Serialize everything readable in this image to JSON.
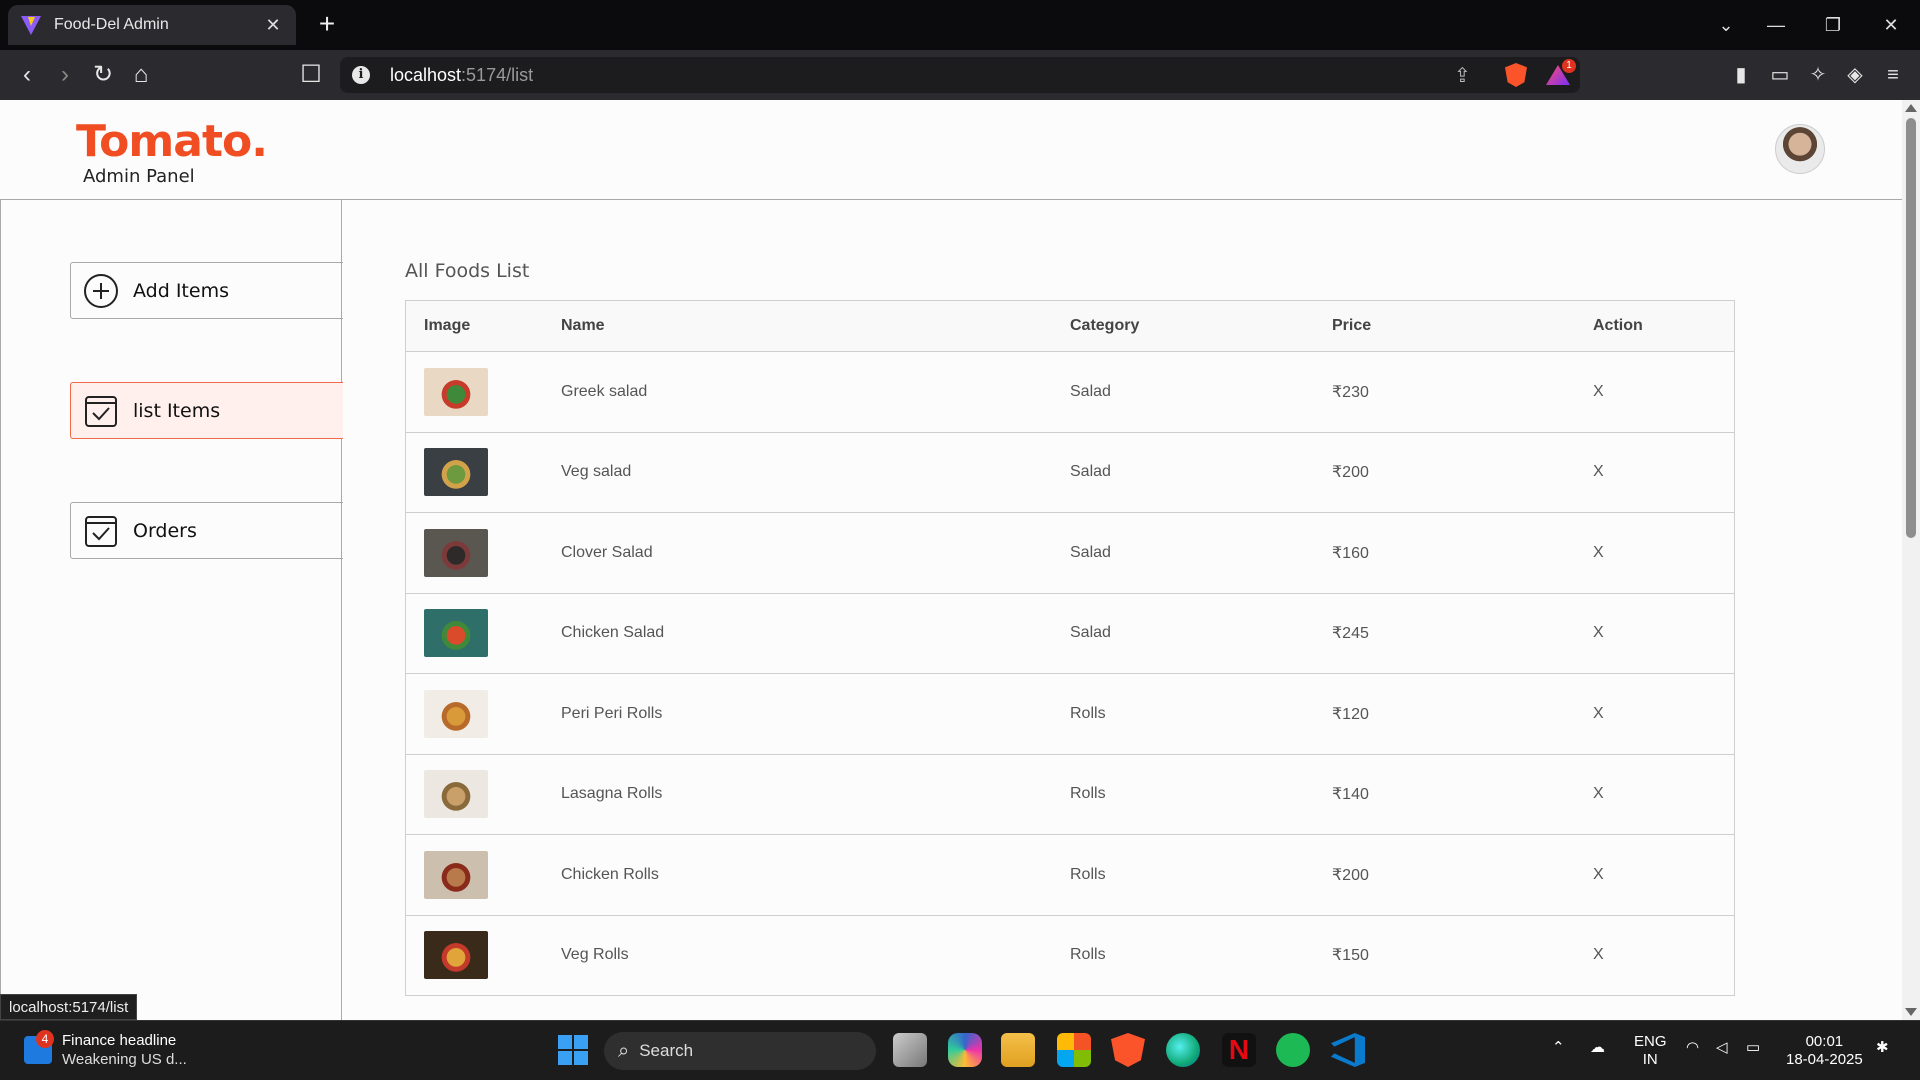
{
  "browser": {
    "tab_title": "Food-Del Admin",
    "tab_close": "✕",
    "new_tab": "+",
    "url_host": "localhost",
    "url_path": ":5174/list",
    "rewards_badge": "1",
    "status_url": "localhost:5174/list"
  },
  "header": {
    "logo": "Tomato.",
    "subtitle": "Admin Panel"
  },
  "sidebar": {
    "items": [
      {
        "label": "Add Items",
        "icon": "plus-circle-icon",
        "active": false
      },
      {
        "label": "list Items",
        "icon": "checklist-icon",
        "active": true
      },
      {
        "label": "Orders",
        "icon": "checklist-icon",
        "active": false
      }
    ]
  },
  "list": {
    "title": "All Foods List",
    "columns": [
      "Image",
      "Name",
      "Category",
      "Price",
      "Action"
    ],
    "rows": [
      {
        "name": "Greek salad",
        "category": "Salad",
        "price": "₹230",
        "action": "X",
        "thumb": [
          "#e9d8c4",
          "#3f8a3a",
          "#c63b2a"
        ]
      },
      {
        "name": "Veg salad",
        "category": "Salad",
        "price": "₹200",
        "action": "X",
        "thumb": [
          "#3a3f44",
          "#6e9a3f",
          "#d1a24a"
        ]
      },
      {
        "name": "Clover Salad",
        "category": "Salad",
        "price": "₹160",
        "action": "X",
        "thumb": [
          "#5a5650",
          "#2f2a2a",
          "#7d3a3a"
        ]
      },
      {
        "name": "Chicken Salad",
        "category": "Salad",
        "price": "₹245",
        "action": "X",
        "thumb": [
          "#2e6f6a",
          "#d94b2a",
          "#3f8a3a"
        ]
      },
      {
        "name": "Peri Peri Rolls",
        "category": "Rolls",
        "price": "₹120",
        "action": "X",
        "thumb": [
          "#f1ede6",
          "#d99a3a",
          "#b86a2a"
        ]
      },
      {
        "name": "Lasagna Rolls",
        "category": "Rolls",
        "price": "₹140",
        "action": "X",
        "thumb": [
          "#ece8e1",
          "#c9a06a",
          "#8a6a3a"
        ]
      },
      {
        "name": "Chicken Rolls",
        "category": "Rolls",
        "price": "₹200",
        "action": "X",
        "thumb": [
          "#cdbfae",
          "#b87a4a",
          "#8a2a1a"
        ]
      },
      {
        "name": "Veg Rolls",
        "category": "Rolls",
        "price": "₹150",
        "action": "X",
        "thumb": [
          "#3a2a1a",
          "#e0a43a",
          "#c43a2a"
        ]
      }
    ]
  },
  "taskbar": {
    "widget_title": "Finance headline",
    "widget_sub": "Weakening US d...",
    "widget_badge": "4",
    "search_label": "Search",
    "lang_top": "ENG",
    "lang_bottom": "IN",
    "time": "00:01",
    "date": "18-04-2025"
  }
}
